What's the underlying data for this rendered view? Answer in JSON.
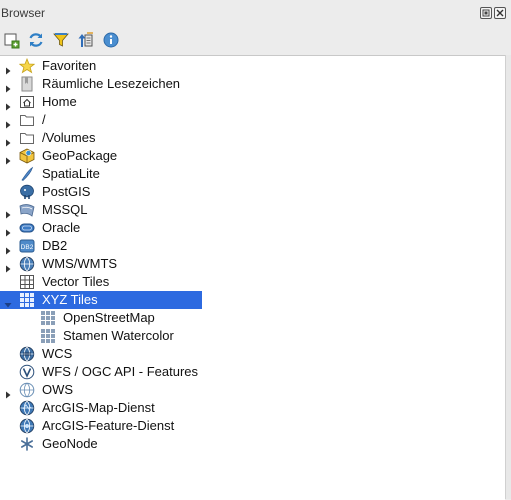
{
  "panel": {
    "title": "Browser"
  },
  "toolbar": {
    "buttons": [
      {
        "name": "add-selected-layers-icon"
      },
      {
        "name": "refresh-icon"
      },
      {
        "name": "filter-icon"
      },
      {
        "name": "collapse-all-icon"
      },
      {
        "name": "properties-info-icon"
      }
    ]
  },
  "tree": {
    "items": [
      {
        "label": "Favoriten",
        "icon": "star-icon",
        "expandable": true
      },
      {
        "label": "Räumliche Lesezeichen",
        "icon": "bookmarks-icon",
        "expandable": true
      },
      {
        "label": "Home",
        "icon": "home-folder-icon",
        "expandable": true
      },
      {
        "label": "/",
        "icon": "folder-icon",
        "expandable": true
      },
      {
        "label": "/Volumes",
        "icon": "folder-icon",
        "expandable": true
      },
      {
        "label": "GeoPackage",
        "icon": "geopackage-icon",
        "expandable": true
      },
      {
        "label": "SpatiaLite",
        "icon": "spatialite-icon",
        "expandable": false
      },
      {
        "label": "PostGIS",
        "icon": "postgis-elephant-icon",
        "expandable": false
      },
      {
        "label": "MSSQL",
        "icon": "mssql-icon",
        "expandable": true
      },
      {
        "label": "Oracle",
        "icon": "oracle-icon",
        "expandable": true
      },
      {
        "label": "DB2",
        "icon": "db2-icon",
        "expandable": true
      },
      {
        "label": "WMS/WMTS",
        "icon": "wms-globe-icon",
        "expandable": true
      },
      {
        "label": "Vector Tiles",
        "icon": "vector-tiles-grid-icon",
        "expandable": false
      },
      {
        "label": "XYZ Tiles",
        "icon": "xyz-tiles-grid-icon",
        "expandable": true,
        "expanded": true,
        "selected": true
      },
      {
        "label": "OpenStreetMap",
        "icon": "tile-grid-icon",
        "child": true
      },
      {
        "label": "Stamen Watercolor",
        "icon": "tile-grid-icon",
        "child": true
      },
      {
        "label": "WCS",
        "icon": "wcs-globe-icon",
        "expandable": false
      },
      {
        "label": "WFS / OGC API - Features",
        "icon": "wfs-globe-icon",
        "expandable": false
      },
      {
        "label": "OWS",
        "icon": "ows-globe-icon",
        "expandable": true
      },
      {
        "label": "ArcGIS-Map-Dienst",
        "icon": "arcgis-map-globe-icon",
        "expandable": false
      },
      {
        "label": "ArcGIS-Feature-Dienst",
        "icon": "arcgis-feature-globe-icon",
        "expandable": false
      },
      {
        "label": "GeoNode",
        "icon": "geonode-icon",
        "expandable": false
      }
    ]
  },
  "colors": {
    "selection": "#2d6ae0",
    "panel_bg": "#ffffff",
    "chrome_bg": "#ececec"
  }
}
